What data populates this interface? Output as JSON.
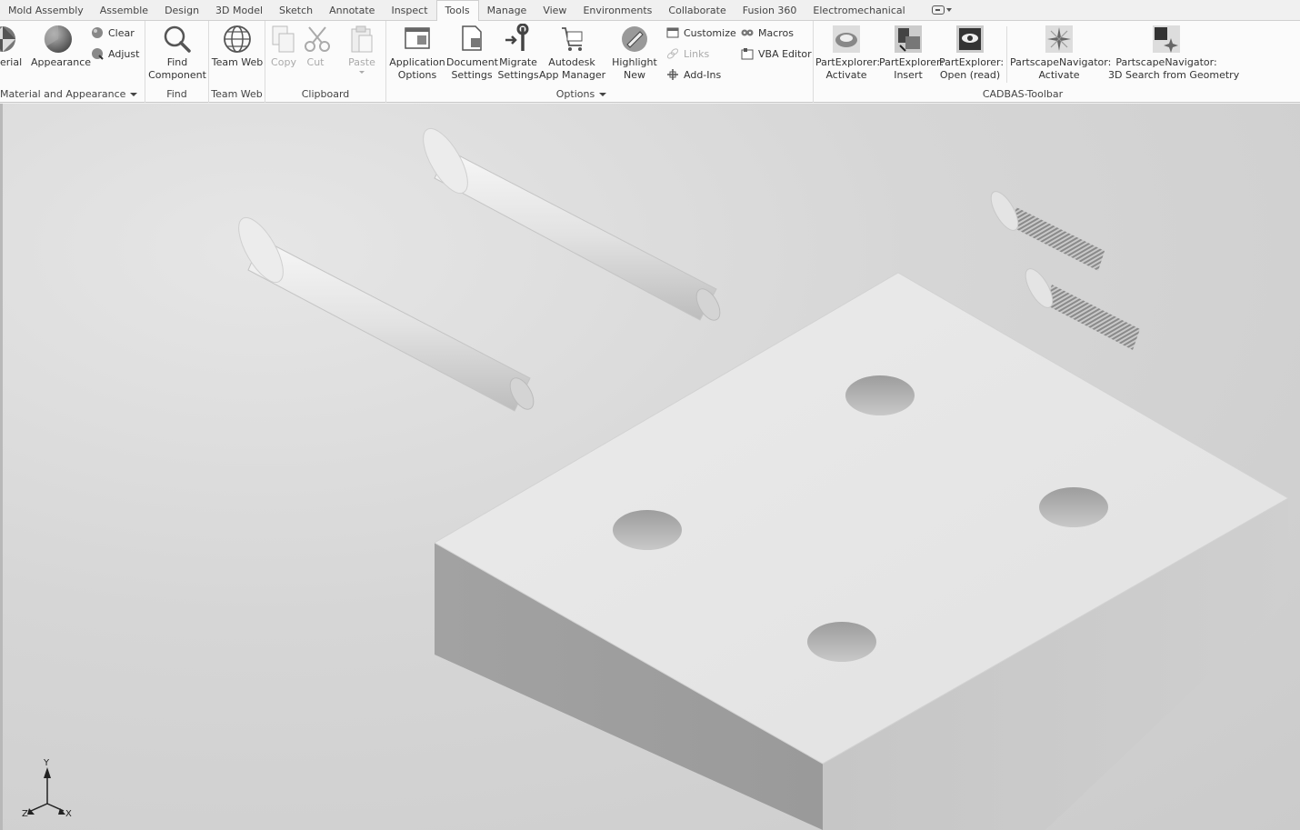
{
  "tabs": [
    "Mold Assembly",
    "Assemble",
    "Design",
    "3D Model",
    "Sketch",
    "Annotate",
    "Inspect",
    "Tools",
    "Manage",
    "View",
    "Environments",
    "Collaborate",
    "Fusion 360",
    "Electromechanical"
  ],
  "active_tab": "Tools",
  "ribbon": {
    "material": {
      "cut_label": "erial",
      "appearance": "Appearance",
      "clear": "Clear",
      "adjust": "Adjust",
      "panel": "Material and Appearance"
    },
    "find": {
      "find_component_1": "Find",
      "find_component_2": "Component",
      "panel": "Find"
    },
    "teamweb": {
      "team_web": "Team Web",
      "panel": "Team Web"
    },
    "clipboard": {
      "copy": "Copy",
      "cut": "Cut",
      "paste": "Paste",
      "panel": "Clipboard"
    },
    "options": {
      "app_options_1": "Application",
      "app_options_2": "Options",
      "doc_settings_1": "Document",
      "doc_settings_2": "Settings",
      "migrate_1": "Migrate",
      "migrate_2": "Settings",
      "autodesk_1": "Autodesk",
      "autodesk_2": "App Manager",
      "highlight_1": "Highlight",
      "highlight_2": "New",
      "customize": "Customize",
      "links": "Links",
      "addins": "Add-Ins",
      "macros": "Macros",
      "vba": "VBA Editor",
      "panel": "Options"
    },
    "cadbas": {
      "pe_activate_1": "PartExplorer:",
      "pe_activate_2": "Activate",
      "pe_insert_1": "PartExplorer:",
      "pe_insert_2": "Insert",
      "pe_open_1": "PartExplorer:",
      "pe_open_2": "Open (read)",
      "pn_activate_1": "PartscapeNavigator:",
      "pn_activate_2": "Activate",
      "pn_search_1": "PartscapeNavigator:",
      "pn_search_2": "3D Search from Geometry",
      "panel": "CADBAS-Toolbar"
    }
  },
  "triad": {
    "x": "X",
    "y": "Y",
    "z": "Z"
  }
}
